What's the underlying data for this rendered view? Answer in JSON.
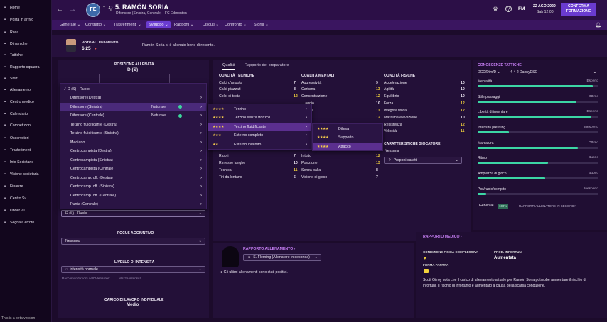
{
  "sidebar": {
    "items": [
      {
        "label": "Home",
        "icon": "home-icon"
      },
      {
        "label": "Posta in arrivo",
        "icon": "inbox-icon"
      },
      {
        "label": "Rosa",
        "icon": "squad-icon"
      },
      {
        "label": "Dinamiche",
        "icon": "dynamics-icon"
      },
      {
        "label": "Tattiche",
        "icon": "tactics-icon"
      },
      {
        "label": "Rapporto squadra",
        "icon": "report-icon"
      },
      {
        "label": "Staff",
        "icon": "staff-icon"
      },
      {
        "label": "Allenamento",
        "icon": "training-icon"
      },
      {
        "label": "Centro medico",
        "icon": "medical-icon"
      },
      {
        "label": "Calendario",
        "icon": "calendar-icon"
      },
      {
        "label": "Competizioni",
        "icon": "trophy-icon"
      },
      {
        "label": "Osservatori",
        "icon": "scouting-icon"
      },
      {
        "label": "Trasferimenti",
        "icon": "transfers-icon"
      },
      {
        "label": "Info Societarie",
        "icon": "club-info-icon"
      },
      {
        "label": "Visione societaria",
        "icon": "vision-icon"
      },
      {
        "label": "Finanze",
        "icon": "finances-icon"
      },
      {
        "label": "Centro Sv.",
        "icon": "dev-centre-icon"
      },
      {
        "label": "Under 21",
        "icon": "u21-icon"
      },
      {
        "label": "Segnala errore",
        "icon": "bug-icon"
      }
    ],
    "footer": "This is a beta version"
  },
  "header": {
    "number_name": "5. RAMÓN SORIA",
    "subtitle": "Difensore (Sinistra, Centrale) - FC Edmonton",
    "date": "22 AGO 2020",
    "day": "Sab 12:00",
    "fm": "FM",
    "confirm_line1": "CONFERMA",
    "confirm_line2": "FORMAZIONE"
  },
  "nav": [
    {
      "label": "Generale ⌄"
    },
    {
      "label": "Contratto ⌄"
    },
    {
      "label": "Trasferimenti ⌄"
    },
    {
      "label": "Sviluppo ⌄"
    },
    {
      "label": "Rapporti ⌄"
    },
    {
      "label": "Discuti ⌄"
    },
    {
      "label": "Confronto ⌄"
    },
    {
      "label": "Storia ⌄"
    }
  ],
  "training": {
    "label": "VOTO ALLENAMENTO",
    "value": "6.25",
    "arrow": "▾",
    "message": "Ramón Soria si è allenato bene di recente."
  },
  "position_panel": {
    "title": "POSIZIONE ALLENATA",
    "value": "D (S)",
    "selected": "D (S) - Ruolo"
  },
  "menu1": [
    {
      "label": "✓ D (S) - Ruolo",
      "tag": ""
    },
    {
      "label": "Difensore (Destra)",
      "tag": ""
    },
    {
      "label": "Difensore (Sinistra)",
      "tag": "Naturale"
    },
    {
      "label": "Difensore (Centrale)",
      "tag": "Naturale"
    },
    {
      "label": "Terzino fluidificante (Destra)",
      "tag": ""
    },
    {
      "label": "Terzino fluidificante (Sinistra)",
      "tag": ""
    },
    {
      "label": "Mediano",
      "tag": ""
    },
    {
      "label": "Centrocampista (Destra)",
      "tag": ""
    },
    {
      "label": "Centrocampista (Sinistra)",
      "tag": ""
    },
    {
      "label": "Centrocampista (Centrale)",
      "tag": ""
    },
    {
      "label": "Centrocamp. off. (Destra)",
      "tag": ""
    },
    {
      "label": "Centrocamp. off. (Sinistra)",
      "tag": ""
    },
    {
      "label": "Centrocamp. off. (Centrale)",
      "tag": ""
    },
    {
      "label": "Punta (Centrale)",
      "tag": ""
    }
  ],
  "menu2": [
    {
      "stars": "★★★★",
      "label": "Terzino"
    },
    {
      "stars": "★★★★",
      "label": "Terzino senza fronzoli"
    },
    {
      "stars": "★★★★",
      "label": "Terzino fluidificante"
    },
    {
      "stars": "★★★",
      "label": "Esterno completo"
    },
    {
      "stars": "★★",
      "label": "Esterno invertito"
    }
  ],
  "menu3": [
    {
      "stars": "★★★★",
      "label": "Difesa"
    },
    {
      "stars": "★★★★",
      "label": "Supporto"
    },
    {
      "stars": "★★★★",
      "label": "Attacco"
    }
  ],
  "tabs": {
    "quality": "Qualità",
    "coach_report": "Rapporto del preparatore"
  },
  "attributes": {
    "technical_title": "QUALITÀ TECNICHE",
    "mental_title": "QUALITÀ MENTALI",
    "physical_title": "QUALITÀ FISICHE",
    "technical": [
      {
        "n": "Calci d'angolo",
        "v": "7"
      },
      {
        "n": "Calci piazzati",
        "v": "8"
      },
      {
        "n": "Colpi di testa",
        "v": "12"
      },
      {
        "n": "Rigori",
        "v": "7"
      },
      {
        "n": "Rimesse lunghe",
        "v": "10"
      },
      {
        "n": "Tecnica",
        "v": "11"
      },
      {
        "n": "Tiri da lontano",
        "v": "5"
      }
    ],
    "mental": [
      {
        "n": "Aggressività",
        "v": "9"
      },
      {
        "n": "Carisma",
        "v": "13"
      },
      {
        "n": "Concentrazione",
        "v": "12"
      },
      {
        "n": "…aggio",
        "v": "10"
      },
      {
        "n": "…sioni",
        "v": "11"
      },
      {
        "n": "…",
        "v": "12"
      },
      {
        "n": "…minazione",
        "v": "11"
      },
      {
        "n": "Intuito",
        "v": "12"
      },
      {
        "n": "Posizione",
        "v": "13"
      },
      {
        "n": "Senza palla",
        "v": "8"
      },
      {
        "n": "Visione di gioco",
        "v": "7"
      }
    ],
    "physical": [
      {
        "n": "Accelerazione",
        "v": "10"
      },
      {
        "n": "Agilità",
        "v": "10"
      },
      {
        "n": "Equilibrio",
        "v": "10"
      },
      {
        "n": "Forza",
        "v": "12"
      },
      {
        "n": "Integrità fisica",
        "v": "12"
      },
      {
        "n": "Massima elevazione",
        "v": "10"
      },
      {
        "n": "Resistenza",
        "v": "12"
      },
      {
        "n": "Velocità",
        "v": "11"
      }
    ],
    "characteristics_title": "CARATTERISTICHE GIOCATORE",
    "characteristics_value": "Nessuna",
    "characteristics_select": "Proponi caratt."
  },
  "focus": {
    "title": "FOCUS AGGIUNTIVO",
    "value": "Nessuno"
  },
  "intensity": {
    "title": "LIVELLO DI INTENSITÀ",
    "value": "Intensità normale",
    "rec_label": "Raccomandazioni dell'Allenatore:",
    "rec_value": "Mezza intensità"
  },
  "workload": {
    "title": "CARICO DI LAVORO INDIVIDUALE",
    "value": "Medio"
  },
  "coach_report": {
    "title": "RAPPORTO ALLENAMENTO ›",
    "select": "S. Fleming (Allenatore in seconda)",
    "bullet": "Gli ultimi allenamenti sono stati positivi."
  },
  "medical": {
    "title": "RAPPORTO MEDICO ›",
    "cond_label": "CONDIZIONE FISICA COMPLESSIVA",
    "risk_label": "PROB. INFORTUNI",
    "risk_value": "Aumentata",
    "form_label": "FORMA PARTITA",
    "text": "Scott Gilroy nota che il carico di allenamento attuale per Ramón Soria potrebbe aumentare il rischio di infortuni. Il rischio di infortunio è aumentato a causa della scarsa condizione."
  },
  "tactical": {
    "title": "CONOSCENZE TATTICHE",
    "role": "DCD/Dim/D",
    "formation": "4-4-2 DannyDSC",
    "bars": [
      {
        "n": "Mentalità",
        "r": "Esperto",
        "v": 0.95
      },
      {
        "n": "Stile passaggi",
        "r": "Ottimo",
        "v": 0.82
      },
      {
        "n": "Libertà di inventare",
        "r": "Esperto",
        "v": 0.94
      },
      {
        "n": "Intensità pressing",
        "r": "Inesperto",
        "v": 0.26
      },
      {
        "n": "Marcatura",
        "r": "Ottimo",
        "v": 0.83
      },
      {
        "n": "Ritmo",
        "r": "Buono",
        "v": 0.58
      },
      {
        "n": "Ampiezza di gioco",
        "r": "Buono",
        "v": 0.56
      },
      {
        "n": "Pos/ruolo/compito",
        "r": "Inesperto",
        "v": 0.07
      }
    ],
    "general_label": "Generale",
    "general_tag": "100%",
    "general_note": "RAPPORTI ALLENATORE IN SECONDA"
  }
}
